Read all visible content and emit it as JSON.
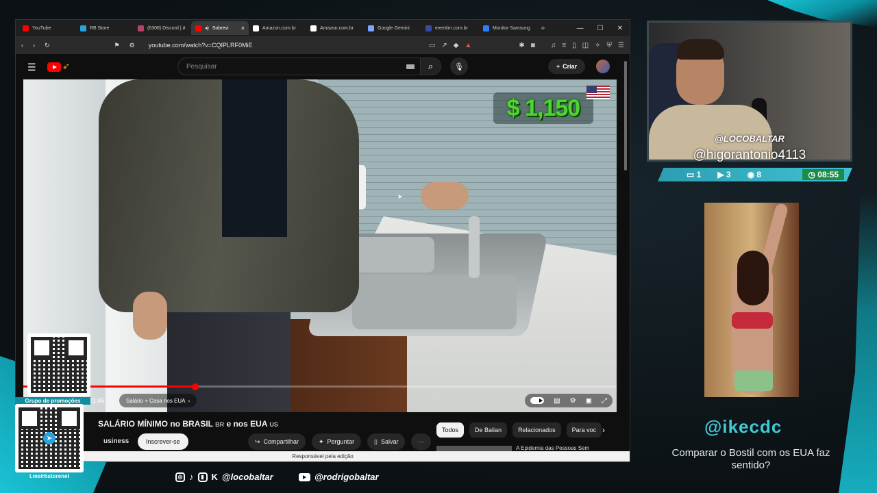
{
  "browser": {
    "tabs": [
      {
        "label": "YouTube",
        "color": "#ff0000",
        "active": false
      },
      {
        "label": "RB Store",
        "color": "#2aa3de",
        "active": false
      },
      {
        "label": "(6308) Discord | #",
        "color": "#b4426b",
        "active": false
      },
      {
        "label": "Sobrevi",
        "color": "#ff0000",
        "active": true
      },
      {
        "label": "Amazon.com.br",
        "color": "#ffffff",
        "active": false
      },
      {
        "label": "Amazon.com.br",
        "color": "#ffffff",
        "active": false
      },
      {
        "label": "Google Gemini",
        "color": "#7aa7ff",
        "active": false
      },
      {
        "label": "eventim.com.br",
        "color": "#3a4aa5",
        "active": false
      },
      {
        "label": "Monitor Samsung",
        "color": "#2d7ff9",
        "active": false
      }
    ],
    "url": "youtube.com/watch?v=CQIPLRF0MiE"
  },
  "youtube": {
    "search_placeholder": "Pesquisar",
    "create_label": "Criar",
    "video": {
      "price_overlay": "$ 1,150",
      "time": "21:46",
      "chapter": "Salário + Casa nos EUA",
      "progress": 0.29
    },
    "title_part1": "SALÁRIO MÍNIMO no BRASIL",
    "title_cc1": "BR",
    "title_part2": "e nos EUA",
    "title_cc2": "US",
    "channel_fragment": "usiness",
    "subscribe_label": "Inscrever-se",
    "actions": {
      "share": "Compartilhar",
      "ask": "Perguntar",
      "save": "Salvar",
      "more": "···"
    },
    "chips": [
      "Todos",
      "De Balian",
      "Relacionados",
      "Para voc"
    ],
    "rec_title": "A Epidemia das Pessoas Sem",
    "footer": "Responsável pela edição"
  },
  "stream": {
    "cam_name": "@LOCOBALTAR",
    "user_handle": "@higorantonio4113",
    "stats": {
      "chat": "1",
      "video": "3",
      "viewers": "8",
      "timer": "08:55"
    },
    "overlay_handle": "@ikecdc",
    "question": "Comparar o Bostil com os EUA faz sentido?",
    "promo_label": "Grupo de promoções",
    "promo_url": "t.me/rbstorenet",
    "social_handle": "@locobaltar",
    "youtube_handle": "@rodrigobaltar"
  }
}
